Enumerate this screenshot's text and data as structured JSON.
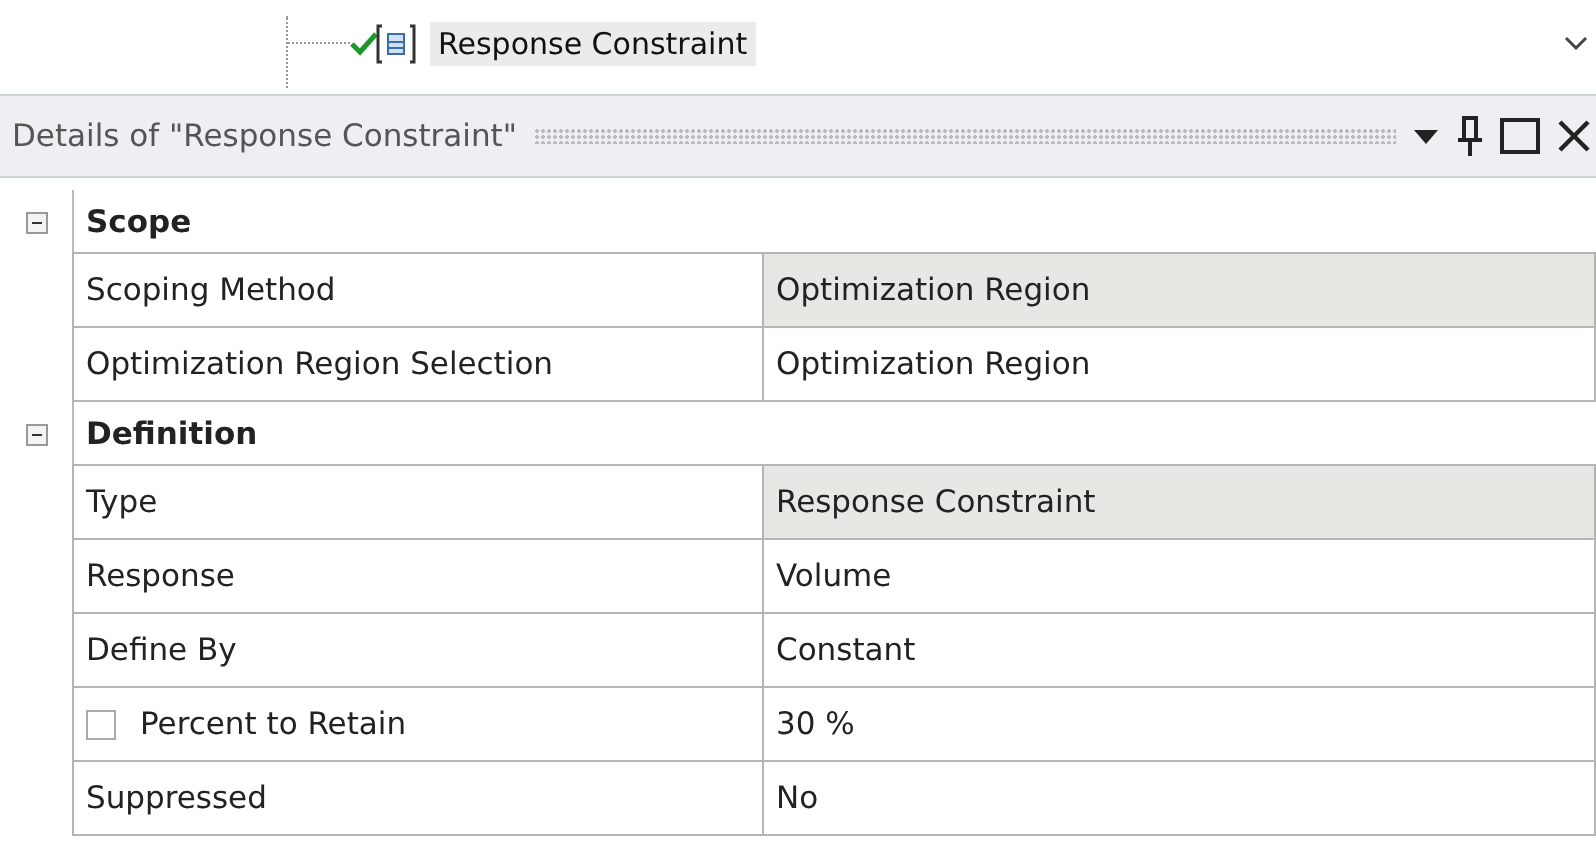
{
  "tree_item": {
    "label": "Response Constraint",
    "selected": true
  },
  "panel": {
    "title": "Details of \"Response Constraint\""
  },
  "sections": [
    {
      "title": "Scope",
      "expanded": true,
      "rows": [
        {
          "kind": "plain",
          "label": "Scoping Method",
          "value": "Optimization Region",
          "shaded": true
        },
        {
          "kind": "plain",
          "label": "Optimization Region Selection",
          "value": "Optimization Region",
          "shaded": false
        }
      ]
    },
    {
      "title": "Definition",
      "expanded": true,
      "rows": [
        {
          "kind": "plain",
          "label": "Type",
          "value": "Response Constraint",
          "shaded": true
        },
        {
          "kind": "plain",
          "label": "Response",
          "value": "Volume",
          "shaded": false
        },
        {
          "kind": "plain",
          "label": "Define By",
          "value": "Constant",
          "shaded": false
        },
        {
          "kind": "checkbox",
          "label": "Percent to Retain",
          "value": "30 %",
          "shaded": false,
          "checked": false
        },
        {
          "kind": "plain",
          "label": "Suppressed",
          "value": "No",
          "shaded": false
        }
      ]
    }
  ]
}
